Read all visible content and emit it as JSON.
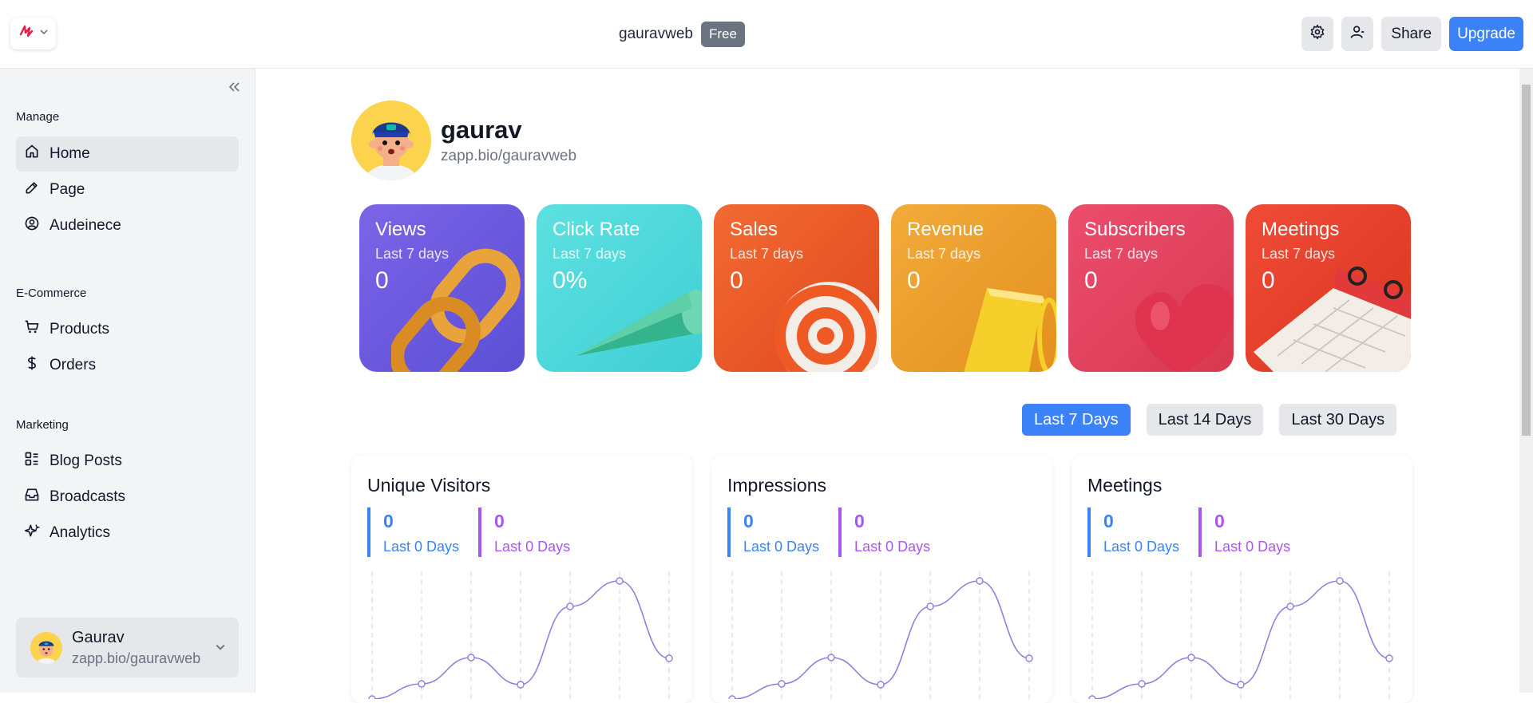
{
  "topbar": {
    "workspace_name": "gauravweb",
    "plan_badge": "Free",
    "share_label": "Share",
    "upgrade_label": "Upgrade",
    "icons": {
      "logo": "bolt-logo-icon",
      "settings": "gear-icon",
      "account": "user-icon"
    }
  },
  "sidebar": {
    "sections": [
      {
        "title": "Manage",
        "items": [
          {
            "label": "Home",
            "icon": "home-icon",
            "active": true
          },
          {
            "label": "Page",
            "icon": "pencil-icon"
          },
          {
            "label": "Audeinece",
            "icon": "user-circle-icon"
          }
        ]
      },
      {
        "title": "E-Commerce",
        "items": [
          {
            "label": "Products",
            "icon": "cart-icon"
          },
          {
            "label": "Orders",
            "icon": "dollar-icon"
          }
        ]
      },
      {
        "title": "Marketing",
        "items": [
          {
            "label": "Blog Posts",
            "icon": "layout-icon"
          },
          {
            "label": "Broadcasts",
            "icon": "inbox-icon"
          },
          {
            "label": "Analytics",
            "icon": "sparkle-icon"
          }
        ]
      }
    ],
    "user": {
      "name": "Gaurav",
      "url": "zapp.bio/gauravweb"
    }
  },
  "profile": {
    "name": "gaurav",
    "url": "zapp.bio/gauravweb"
  },
  "stats": [
    {
      "title": "Views",
      "subtitle": "Last 7 days",
      "value": "0",
      "color": "#6d5ae0"
    },
    {
      "title": "Click Rate",
      "subtitle": "Last 7 days",
      "value": "0%",
      "color": "#4fd8d8"
    },
    {
      "title": "Sales",
      "subtitle": "Last 7 days",
      "value": "0",
      "color": "#e8552b"
    },
    {
      "title": "Revenue",
      "subtitle": "Last 7 days",
      "value": "0",
      "color": "#eba030"
    },
    {
      "title": "Subscribers",
      "subtitle": "Last 7 days",
      "value": "0",
      "color": "#e3465f"
    },
    {
      "title": "Meetings",
      "subtitle": "Last 7 days",
      "value": "0",
      "color": "#e63d2f"
    }
  ],
  "ranges": [
    {
      "label": "Last 7 Days",
      "active": true
    },
    {
      "label": "Last 14 Days"
    },
    {
      "label": "Last 30 Days"
    }
  ],
  "panels": [
    {
      "title": "Unique Visitors",
      "current": {
        "value": "0",
        "label": "Last 0 Days"
      },
      "previous": {
        "value": "0",
        "label": "Last 0 Days"
      }
    },
    {
      "title": "Impressions",
      "current": {
        "value": "0",
        "label": "Last 0 Days"
      },
      "previous": {
        "value": "0",
        "label": "Last 0 Days"
      }
    },
    {
      "title": "Meetings",
      "current": {
        "value": "0",
        "label": "Last 0 Days"
      },
      "previous": {
        "value": "0",
        "label": "Last 0 Days"
      }
    }
  ],
  "accent_colors": {
    "primary": "#3b82f6",
    "secondary": "#a855f7",
    "line": "#8b80e0"
  }
}
